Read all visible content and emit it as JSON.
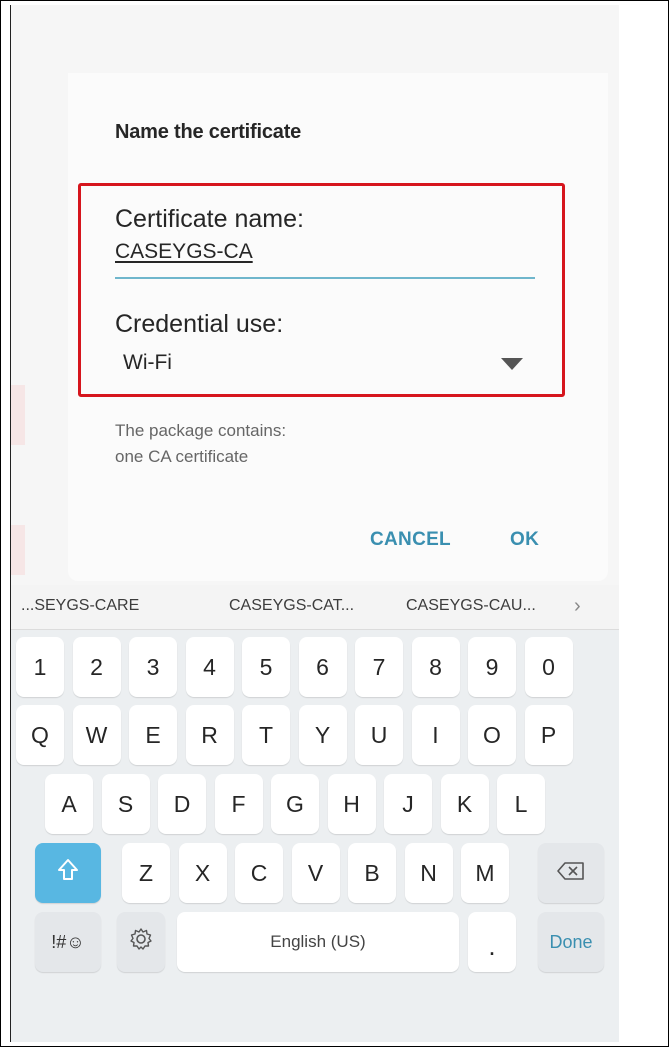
{
  "dialog": {
    "title": "Name the certificate",
    "cert_name_label": "Certificate name:",
    "cert_name_value": "CASEYGS-CA",
    "credential_label": "Credential use:",
    "credential_value": "Wi-Fi",
    "info_line1": "The package contains:",
    "info_line2": "one CA certificate",
    "cancel_label": "CANCEL",
    "ok_label": "OK",
    "highlight_color": "#d6151d",
    "accent_color": "#3a8fb0"
  },
  "keyboard": {
    "suggestions": [
      "...SEYGS-CARE",
      "CASEYGS-CAT...",
      "CASEYGS-CAU..."
    ],
    "suggest_more_icon": "chevron-right-icon",
    "number_row": [
      "1",
      "2",
      "3",
      "4",
      "5",
      "6",
      "7",
      "8",
      "9",
      "0"
    ],
    "row1": [
      "Q",
      "W",
      "E",
      "R",
      "T",
      "Y",
      "U",
      "I",
      "O",
      "P"
    ],
    "row2": [
      "A",
      "S",
      "D",
      "F",
      "G",
      "H",
      "J",
      "K",
      "L"
    ],
    "row3": [
      "Z",
      "X",
      "C",
      "V",
      "B",
      "N",
      "M"
    ],
    "shift_icon": "shift-arrow-icon",
    "backspace_icon": "backspace-icon",
    "symbols_label": "!#☺",
    "settings_icon": "gear-icon",
    "space_label": "English (US)",
    "period_label": ".",
    "done_label": "Done",
    "shift_color": "#58b7e2"
  }
}
